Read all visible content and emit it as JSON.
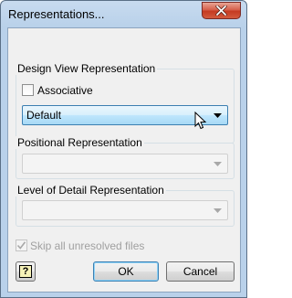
{
  "window": {
    "title": "Representations..."
  },
  "design_view": {
    "group_label": "Design View Representation",
    "associative_label": "Associative",
    "associative_checked": false,
    "combo_value": "Default"
  },
  "positional": {
    "group_label": "Positional Representation",
    "combo_value": ""
  },
  "level_of_detail": {
    "group_label": "Level of Detail Representation",
    "combo_value": ""
  },
  "skip_unresolved": {
    "label": "Skip all unresolved files",
    "checked": true
  },
  "buttons": {
    "ok": "OK",
    "cancel": "Cancel",
    "help_glyph": "?"
  },
  "icons": [
    "close-icon",
    "dropdown-arrow-icon",
    "help-icon",
    "mouse-cursor-icon",
    "checkmark-icon"
  ]
}
